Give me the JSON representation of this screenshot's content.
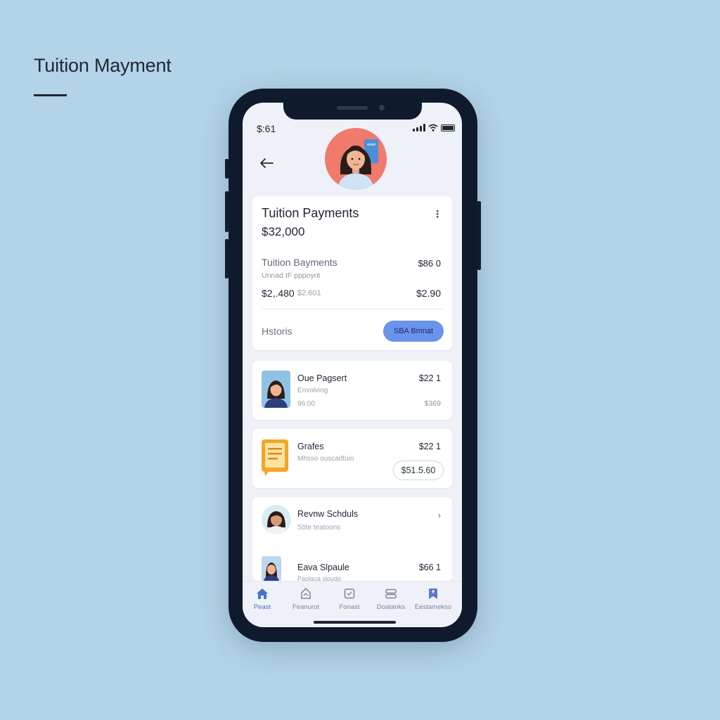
{
  "page": {
    "title": "Tuition Mayment"
  },
  "status_bar": {
    "time": "$:61"
  },
  "summary": {
    "title": "Tuition Payments",
    "total": "$32,000",
    "sub_title": "Tuition Bayments",
    "sub_caption": "Unnad IF pppoynt",
    "sub_amount": "$86 0",
    "paid_amount": "$2,.480",
    "paid_secondary": "$2.601",
    "due_amount": "$2.90",
    "history_label": "Hstoris",
    "button_label": "SBA Bmnat"
  },
  "items": [
    {
      "title": "Oue Pagsert",
      "subtitle": "Envolving",
      "subtitle2": "96:00",
      "amount": "$22 1",
      "amount2": "$369"
    },
    {
      "title": "Grafes",
      "subtitle": "Mhsso ouscadtuio",
      "amount": "$22 1",
      "pill_amount": "$51.5.60"
    },
    {
      "title": "Revnw Schduls",
      "subtitle": "Stite teatoons"
    },
    {
      "title": "Eava Slpaule",
      "subtitle": "Paolaua sloudo",
      "amount": "$66 1"
    }
  ],
  "tabs": [
    {
      "label": "Peast",
      "icon": "home-icon",
      "active": true
    },
    {
      "label": "Feanurot",
      "icon": "document-icon"
    },
    {
      "label": "Fonast",
      "icon": "calendar-icon"
    },
    {
      "label": "Doatanks",
      "icon": "stack-icon"
    },
    {
      "label": "Eestamekso",
      "icon": "bookmark-icon"
    }
  ],
  "colors": {
    "background": "#b3d3e8",
    "accent": "#6a93ec",
    "phone_frame": "#0f1b2c",
    "avatar_bg": "#f07a6c"
  }
}
